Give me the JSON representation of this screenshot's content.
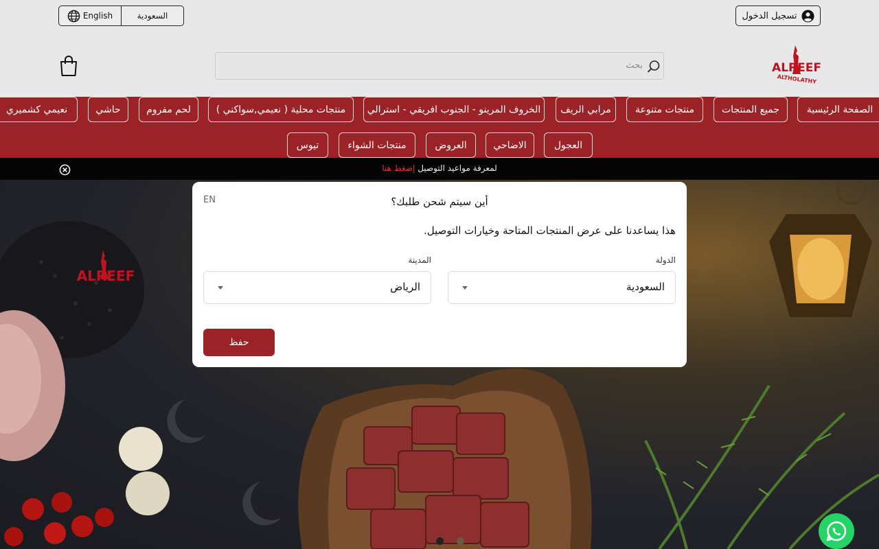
{
  "header": {
    "language_label": "English",
    "country_label": "السعودية",
    "login_label": "تسجيل الدخول",
    "search_placeholder": "بحث",
    "logo_text_top": "ALREEF",
    "logo_text_bottom": "ALTHOLATHY"
  },
  "nav": {
    "row1": [
      "الصفحة الرئيسية",
      "جميع المنتجات",
      "منتجات متنوعة",
      "مرابي الريف",
      "الخروف المرينو - الجنوب افريقي - استرالي",
      "منتجات محلية ( نعيمي,سواكني )",
      "لحم مفروم",
      "حاشي",
      "نعيمي كشميري"
    ],
    "row2": [
      "العجول",
      "الاضاحي",
      "العروض",
      "منتجات الشواء",
      "تيوس"
    ]
  },
  "notice": {
    "text": "لمعرفة مواعيد التوصيل ",
    "link": "إضغط هنا"
  },
  "modal": {
    "lang_switch": "EN",
    "title": "أين سيتم شحن طلبك؟",
    "description": "هذا يساعدنا على عرض المنتجات المتاحة وخيارات التوصيل.",
    "country_label": "الدولة",
    "country_value": "السعودية",
    "city_label": "المدينة",
    "city_value": "الرياض",
    "save_label": "حفظ"
  },
  "hero": {
    "logo_text": "ALREEF"
  },
  "colors": {
    "brand_red": "#9b2226",
    "whatsapp_green": "#25d366"
  }
}
